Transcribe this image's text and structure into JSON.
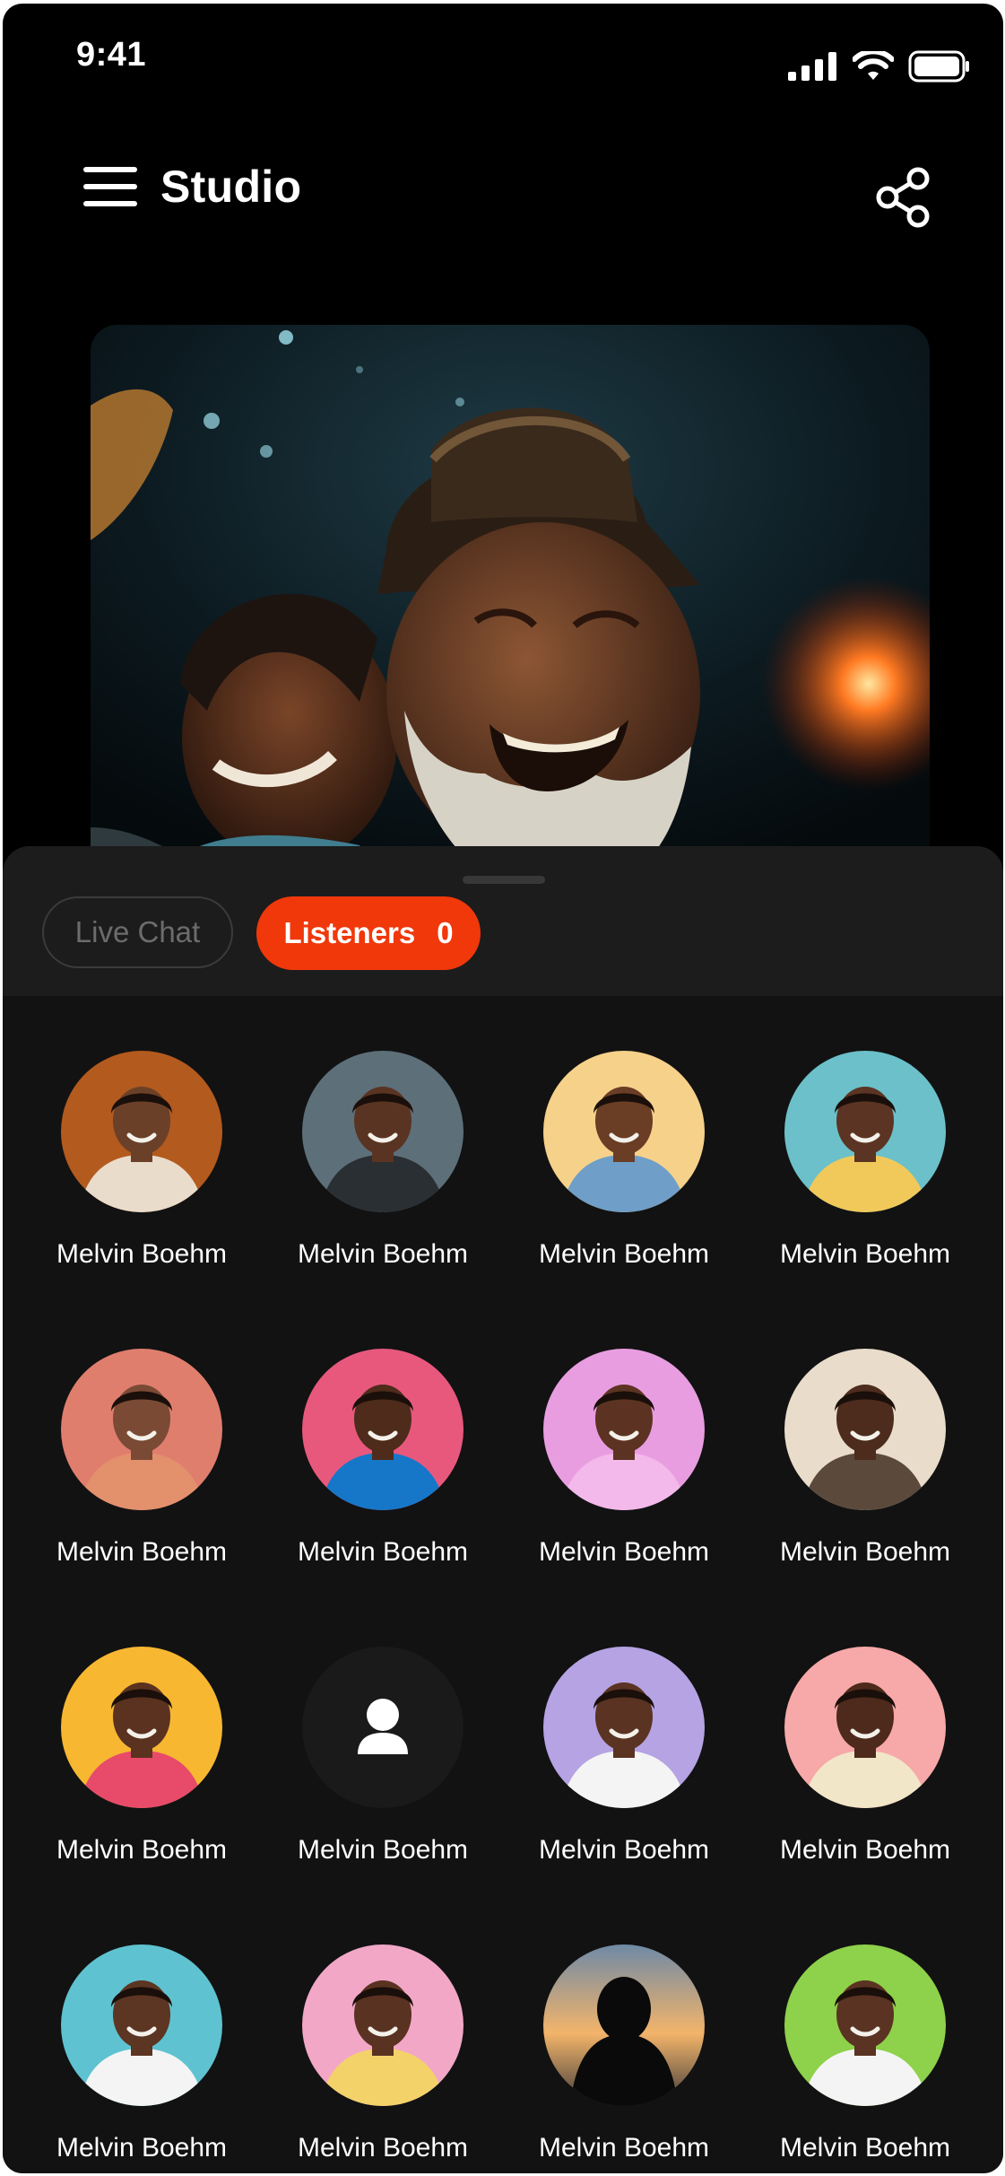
{
  "status_bar": {
    "time": "9:41"
  },
  "header": {
    "title": "Studio",
    "menu_icon": "hamburger-menu-icon",
    "share_icon": "share-icon"
  },
  "video": {
    "description_icon": "live-video-feed"
  },
  "tabs": {
    "live_chat": "Live Chat",
    "listeners_label": "Listeners",
    "listeners_count": "0"
  },
  "colors": {
    "accent": "#f0380b",
    "background": "#000000",
    "sheet": "#121212"
  },
  "listeners": [
    {
      "name": "Melvin Boehm",
      "bg": "#b35a1e",
      "skin": "#6b4028",
      "shirt": "#e9dccb",
      "avatar": "photo"
    },
    {
      "name": "Melvin Boehm",
      "bg": "#5d6f79",
      "skin": "#5a3422",
      "shirt": "#2a2f33",
      "avatar": "photo"
    },
    {
      "name": "Melvin Boehm",
      "bg": "#f6d18a",
      "skin": "#6a3d25",
      "shirt": "#6f9ec8",
      "avatar": "photo"
    },
    {
      "name": "Melvin Boehm",
      "bg": "#6cc0c9",
      "skin": "#5b3423",
      "shirt": "#f1c95a",
      "avatar": "photo"
    },
    {
      "name": "Melvin Boehm",
      "bg": "#e07e6e",
      "skin": "#7a4a35",
      "shirt": "#e3906d",
      "avatar": "photo"
    },
    {
      "name": "Melvin Boehm",
      "bg": "#e8587d",
      "skin": "#4e2b1b",
      "shirt": "#1677c8",
      "avatar": "photo"
    },
    {
      "name": "Melvin Boehm",
      "bg": "#e99de1",
      "skin": "#5c3322",
      "shirt": "#f3b9ea",
      "avatar": "photo"
    },
    {
      "name": "Melvin Boehm",
      "bg": "#e9dccb",
      "skin": "#4d2c1d",
      "shirt": "#5b4a3c",
      "avatar": "photo"
    },
    {
      "name": "Melvin Boehm",
      "bg": "#f7b731",
      "skin": "#5a321f",
      "shirt": "#e84a6a",
      "avatar": "photo"
    },
    {
      "name": "Melvin Boehm",
      "bg": "#1a1a1a",
      "skin": "#ffffff",
      "shirt": "#ffffff",
      "avatar": "placeholder"
    },
    {
      "name": "Melvin Boehm",
      "bg": "#b5a3e4",
      "skin": "#5a3322",
      "shirt": "#f4f4f4",
      "avatar": "photo"
    },
    {
      "name": "Melvin Boehm",
      "bg": "#f7a8a8",
      "skin": "#4d2a1b",
      "shirt": "#f1e6c8",
      "avatar": "photo"
    },
    {
      "name": "Melvin Boehm",
      "bg": "#5fc2d0",
      "skin": "#5c3523",
      "shirt": "#f4f4f4",
      "avatar": "photo"
    },
    {
      "name": "Melvin Boehm",
      "bg": "#f2a7c7",
      "skin": "#5a3221",
      "shirt": "#f4d26a",
      "avatar": "photo"
    },
    {
      "name": "Melvin Boehm",
      "bg": "#d2a46b",
      "skin": "#0a0a0a",
      "shirt": "#0a0a0a",
      "avatar": "silhouette"
    },
    {
      "name": "Melvin Boehm",
      "bg": "#8ed14a",
      "skin": "#5a3322",
      "shirt": "#f4f4f4",
      "avatar": "photo"
    }
  ]
}
